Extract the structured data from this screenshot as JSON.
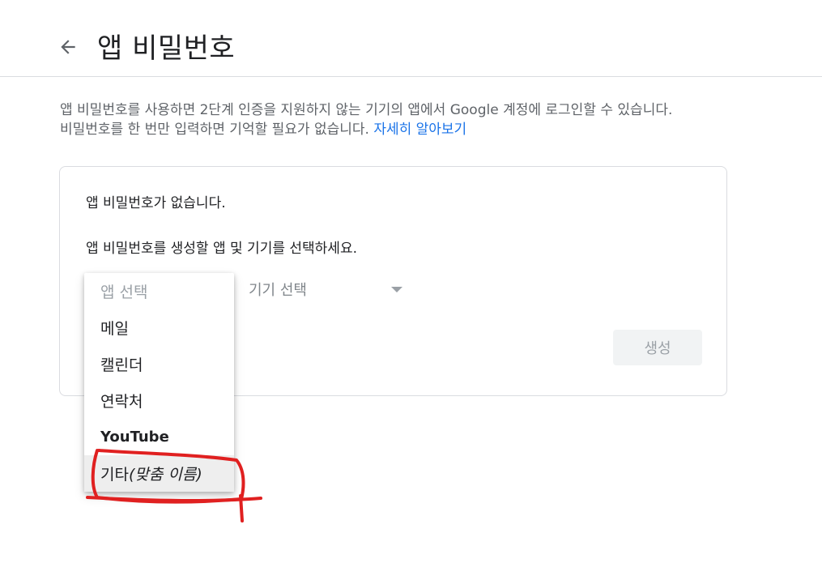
{
  "header": {
    "title": "앱 비밀번호"
  },
  "description": {
    "line1": "앱 비밀번호를 사용하면 2단계 인증을 지원하지 않는 기기의 앱에서 Google 계정에 로그인할 수 있습니다.",
    "line2": "비밀번호를 한 번만 입력하면 기억할 필요가 없습니다. ",
    "learn_more": "자세히 알아보기"
  },
  "card": {
    "no_passwords": "앱 비밀번호가 없습니다.",
    "select_hint": "앱 비밀번호를 생성할 앱 및 기기를 선택하세요.",
    "device_select_label": "기기 선택",
    "generate_label": "생성"
  },
  "app_menu": {
    "placeholder": "앱 선택",
    "items": [
      "메일",
      "캘린더",
      "연락처",
      "YouTube"
    ],
    "other_prefix": "기타",
    "other_suffix": "(맞춤 이름)"
  },
  "colors": {
    "link": "#1a73e8",
    "annotation": "#e02020",
    "disabled": "#9aa0a6"
  }
}
